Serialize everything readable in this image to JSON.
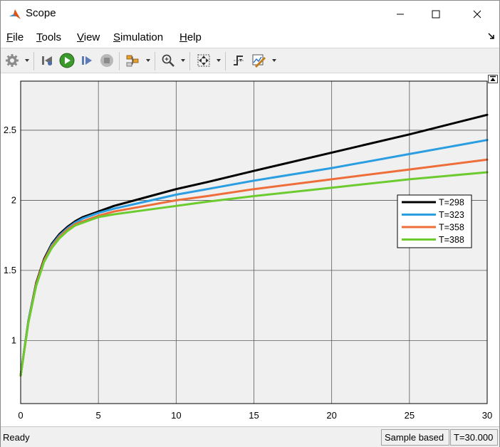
{
  "window": {
    "title": "Scope",
    "icon": "matlab-logo-icon"
  },
  "menu": [
    {
      "label": "File",
      "underline": "F",
      "rest": "ile"
    },
    {
      "label": "Tools",
      "underline": "T",
      "rest": "ools"
    },
    {
      "label": "View",
      "underline": "V",
      "rest": "iew"
    },
    {
      "label": "Simulation",
      "underline": "S",
      "rest": "imulation"
    },
    {
      "label": "Help",
      "underline": "H",
      "rest": "elp"
    }
  ],
  "toolbar": {
    "icons": [
      "gear-icon",
      "step-back-icon",
      "run-icon",
      "step-forward-icon",
      "stop-icon",
      "signal-highlight-icon",
      "zoom-icon",
      "autoscale-icon",
      "triggers-icon",
      "measurements-icon"
    ]
  },
  "status": {
    "text": "Ready",
    "mode": "Sample based",
    "time": "T=30.000"
  },
  "chart_data": {
    "type": "line",
    "title": "",
    "xlabel": "",
    "ylabel": "",
    "xlim": [
      0,
      30
    ],
    "ylim": [
      0.55,
      2.85
    ],
    "xticks": [
      0,
      5,
      10,
      15,
      20,
      25,
      30
    ],
    "xtick_labels": [
      "0",
      "5",
      "10",
      "15",
      "20",
      "25",
      "30"
    ],
    "yticks": [
      1,
      1.5,
      2,
      2.5
    ],
    "ytick_labels": [
      "1",
      "1.5",
      "2",
      "2.5"
    ],
    "grid": true,
    "legend_position": "right",
    "background": "#f0f0f0",
    "x": [
      0,
      0.5,
      1,
      1.5,
      2,
      2.5,
      3,
      3.5,
      4,
      5,
      6,
      8,
      10,
      12,
      15,
      20,
      25,
      30
    ],
    "series": [
      {
        "name": "T=298",
        "color": "#000000",
        "values": [
          0.75,
          1.14,
          1.41,
          1.58,
          1.69,
          1.76,
          1.81,
          1.85,
          1.88,
          1.92,
          1.96,
          2.02,
          2.08,
          2.13,
          2.21,
          2.34,
          2.47,
          2.61
        ]
      },
      {
        "name": "T=323",
        "color": "#2a9ee0",
        "values": [
          0.75,
          1.14,
          1.4,
          1.57,
          1.68,
          1.75,
          1.8,
          1.84,
          1.87,
          1.91,
          1.94,
          1.99,
          2.04,
          2.08,
          2.14,
          2.23,
          2.33,
          2.43
        ]
      },
      {
        "name": "T=358",
        "color": "#ee6e3a",
        "values": [
          0.75,
          1.13,
          1.4,
          1.57,
          1.67,
          1.74,
          1.79,
          1.83,
          1.85,
          1.89,
          1.92,
          1.96,
          2.0,
          2.03,
          2.08,
          2.15,
          2.22,
          2.29
        ]
      },
      {
        "name": "T=388",
        "color": "#6ccb2e",
        "values": [
          0.75,
          1.13,
          1.39,
          1.56,
          1.66,
          1.73,
          1.78,
          1.82,
          1.84,
          1.88,
          1.9,
          1.93,
          1.96,
          1.99,
          2.03,
          2.09,
          2.15,
          2.2
        ]
      }
    ]
  }
}
